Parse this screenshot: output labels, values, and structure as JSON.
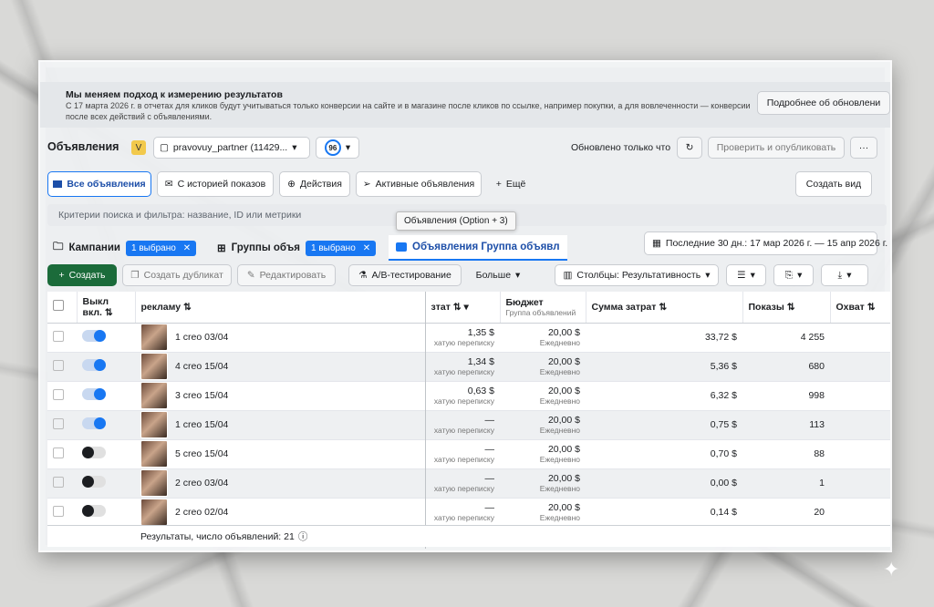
{
  "notice": {
    "title": "Мы меняем подход к измерению результатов",
    "text": "С 17 марта 2026 г. в отчетах для кликов будут учитываться только конверсии на сайте и в магазине после кликов по ссылке, например покупки, а для вовлеченности — конверсии после всех действий с объявлениями.",
    "more_button": "Подробнее об обновлени"
  },
  "header": {
    "title": "Объявления",
    "account_badge": "V",
    "account_name": "pravovuy_partner (11429...",
    "score": "96",
    "updated": "Обновлено только что",
    "publish_button": "Проверить и опубликовать",
    "more": "···"
  },
  "tabs": [
    {
      "label": "Все объявления",
      "icon": "grid-icon"
    },
    {
      "label": "С историей показов",
      "icon": "inbox-icon"
    },
    {
      "label": "Действия",
      "icon": "plus-circle-icon"
    },
    {
      "label": "Активные объявления",
      "icon": "send-icon"
    },
    {
      "label": "Ещё",
      "icon": "plus-icon"
    }
  ],
  "create_view": "Создать вид",
  "search_placeholder": "Критерии поиска и фильтра: название, ID или метрики",
  "tooltip": "Объявления (Option + 3)",
  "levels": {
    "campaigns": "Кампании",
    "campaigns_chip": "1 выбрано",
    "adsets": "Группы объя",
    "adsets_chip": "1 выбрано",
    "ads": "Объявления Группа объявл"
  },
  "date_range": "Последние 30 дн.: 17 мар 2026 г. — 15 апр 2026 г.",
  "toolbar": {
    "create": "Создать",
    "duplicate": "Создать дубликат",
    "edit": "Редактировать",
    "ab": "A/B-тестирование",
    "more": "Больше",
    "columns": "Столбцы: Результативность"
  },
  "columns": {
    "toggle": "Выкл вкл.",
    "name": "рекламу",
    "result": "зтат",
    "budget": "Бюджет",
    "budget_sub": "Группа объявлений",
    "spend": "Сумма затрат",
    "impressions": "Показы",
    "reach": "Охват"
  },
  "rows": [
    {
      "on": true,
      "name": "1 creo 03/04",
      "result": "1,35 $",
      "result_sub": "хатую переписку",
      "budget": "20,00 $",
      "budget_sub": "Ежедневно",
      "spend": "33,72 $",
      "impressions": "4 255"
    },
    {
      "on": true,
      "name": "4 creo 15/04",
      "result": "1,34 $",
      "result_sub": "хатую переписку",
      "budget": "20,00 $",
      "budget_sub": "Ежедневно",
      "spend": "5,36 $",
      "impressions": "680"
    },
    {
      "on": true,
      "name": "3 creo 15/04",
      "result": "0,63 $",
      "result_sub": "хатую переписку",
      "budget": "20,00 $",
      "budget_sub": "Ежедневно",
      "spend": "6,32 $",
      "impressions": "998"
    },
    {
      "on": true,
      "name": "1 creo 15/04",
      "result": "—",
      "result_sub": "хатую переписку",
      "budget": "20,00 $",
      "budget_sub": "Ежедневно",
      "spend": "0,75 $",
      "impressions": "113"
    },
    {
      "on": false,
      "name": "5 creo 15/04",
      "result": "—",
      "result_sub": "хатую переписку",
      "budget": "20,00 $",
      "budget_sub": "Ежедневно",
      "spend": "0,70 $",
      "impressions": "88"
    },
    {
      "on": false,
      "name": "2 creo 03/04",
      "result": "—",
      "result_sub": "хатую переписку",
      "budget": "20,00 $",
      "budget_sub": "Ежедневно",
      "spend": "0,00 $",
      "impressions": "1"
    },
    {
      "on": false,
      "name": "2 creo 02/04",
      "result": "—",
      "result_sub": "хатую переписку",
      "budget": "20,00 $",
      "budget_sub": "Ежедневно",
      "spend": "0,14 $",
      "impressions": "20"
    }
  ],
  "footer": "Результаты, число объявлений: 21",
  "colors": {
    "accent": "#1877f2",
    "create_button": "#1b6b3a"
  }
}
